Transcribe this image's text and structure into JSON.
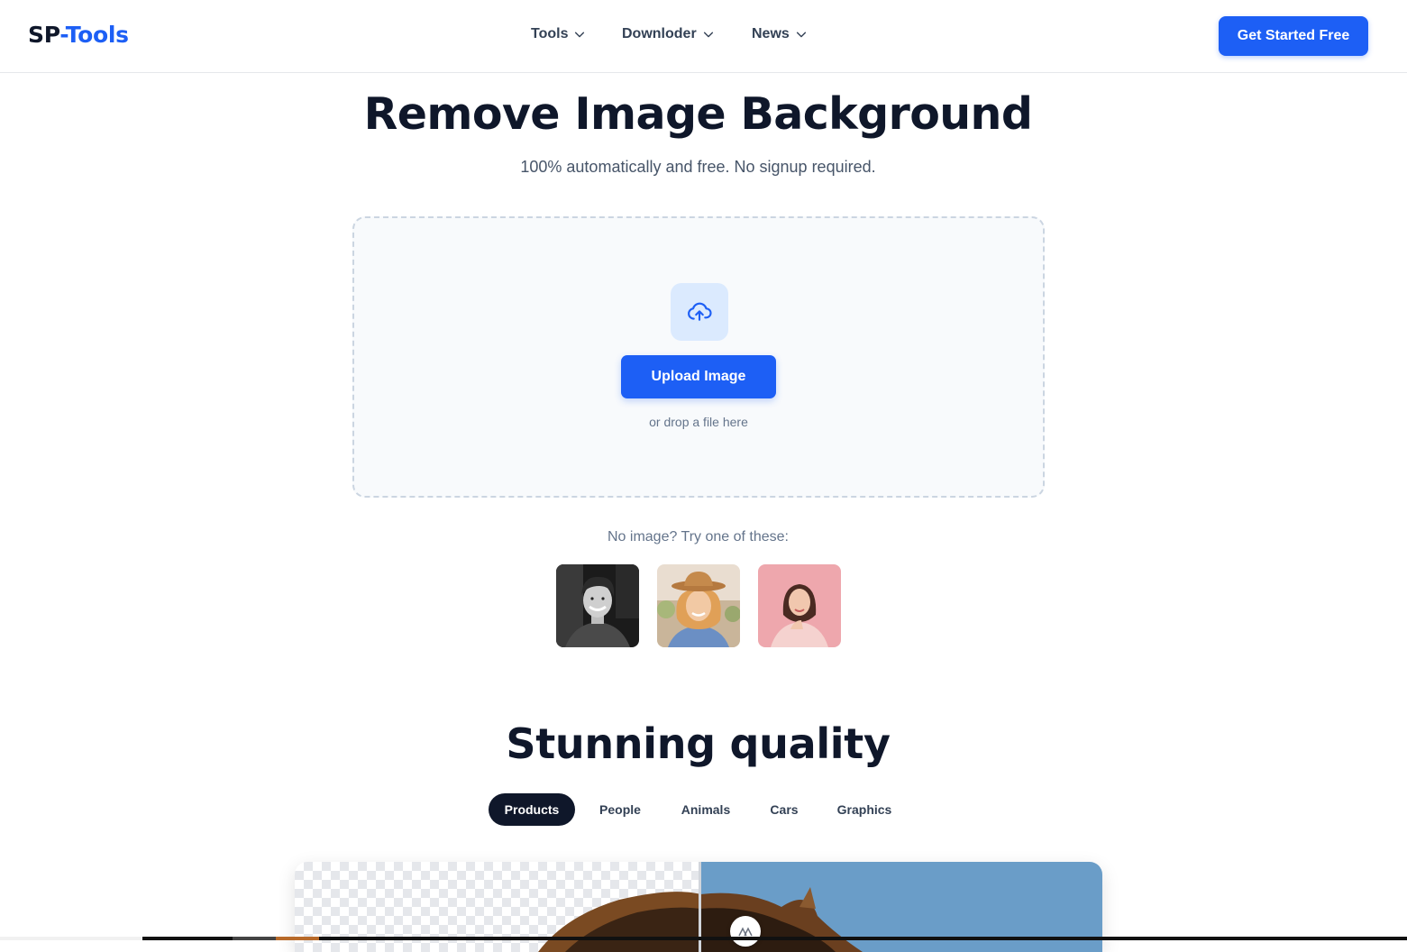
{
  "header": {
    "logo_part1": "SP",
    "logo_part2": "-Tools",
    "nav": [
      {
        "label": "Tools",
        "icon": "chevron-down-icon"
      },
      {
        "label": "Downloder",
        "icon": "chevron-down-icon"
      },
      {
        "label": "News",
        "icon": "chevron-down-icon"
      }
    ],
    "cta_label": "Get Started Free"
  },
  "hero": {
    "title": "Remove Image Background",
    "subtitle": "100% automatically and free. No signup required."
  },
  "dropzone": {
    "icon": "cloud-upload-icon",
    "button_label": "Upload Image",
    "hint": "or drop a file here"
  },
  "samples": {
    "label": "No image? Try one of these:",
    "items": [
      "sample-man-bw",
      "sample-woman-hat",
      "sample-woman-pink"
    ]
  },
  "quality": {
    "title": "Stunning quality",
    "tabs": [
      {
        "label": "Products",
        "active": true
      },
      {
        "label": "People",
        "active": false
      },
      {
        "label": "Animals",
        "active": false
      },
      {
        "label": "Cars",
        "active": false
      },
      {
        "label": "Graphics",
        "active": false
      }
    ]
  },
  "colors": {
    "brand_blue": "#1d5ff5",
    "dark": "#0f172a",
    "muted": "#64748b"
  }
}
